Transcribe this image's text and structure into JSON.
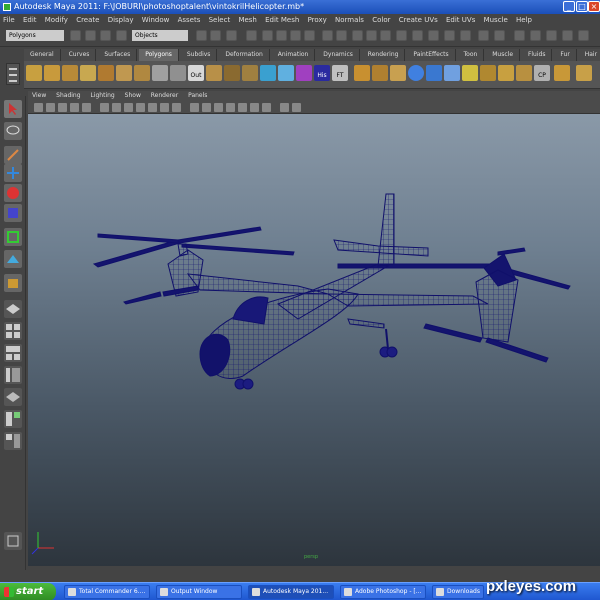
{
  "window": {
    "title": "Autodesk Maya 2011: F:\\JOBURI\\photoshoptalent\\vintokrilHelicopter.mb*",
    "minimize_icon": "minimize-icon",
    "maximize_icon": "maximize-icon",
    "close_icon": "close-icon"
  },
  "menubar": [
    "File",
    "Edit",
    "Modify",
    "Create",
    "Display",
    "Window",
    "Assets",
    "Select",
    "Mesh",
    "Edit Mesh",
    "Proxy",
    "Normals",
    "Color",
    "Create UVs",
    "Edit UVs",
    "Muscle",
    "Help"
  ],
  "statusline": {
    "mode": "Polygons",
    "object_field": "Objects"
  },
  "shelf_tabs": [
    "General",
    "Curves",
    "Surfaces",
    "Polygons",
    "Subdivs",
    "Deformation",
    "Animation",
    "Dynamics",
    "Rendering",
    "PaintEffects",
    "Toon",
    "Muscle",
    "Fluids",
    "Fur",
    "Hair"
  ],
  "shelf_active_tab": "Polygons",
  "shelf_icon_labels": {
    "out": "Out",
    "his": "His",
    "ft": "FT",
    "cp": "CP"
  },
  "viewport_menu": [
    "View",
    "Shading",
    "Lighting",
    "Show",
    "Renderer",
    "Panels"
  ],
  "viewport": {
    "camera_label": "persp"
  },
  "taskbar": {
    "start_label": "start",
    "tasks": [
      "Total Commander 6....",
      "Output Window",
      "Autodesk Maya 201...",
      "Adobe Photoshop - [...",
      "Downloads"
    ]
  },
  "watermark": "pxleyes.com",
  "colors": {
    "titlebar": "#2a5fcc",
    "wireframe": "#1a1a8c",
    "viewport_top": "#8a99a8",
    "viewport_bottom": "#2d353d",
    "taskbar": "#2d68e0",
    "start": "#3aa02e"
  }
}
